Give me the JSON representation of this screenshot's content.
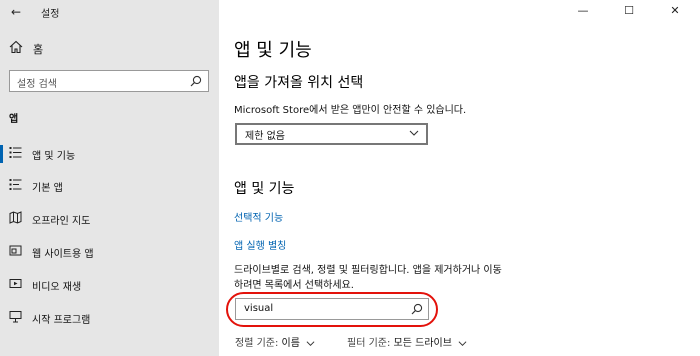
{
  "window": {
    "app_title": "설정",
    "back_glyph": "←",
    "minimize_glyph": "—",
    "maximize_glyph": "☐",
    "close_glyph": "✕"
  },
  "sidebar": {
    "home_label": "홈",
    "search_placeholder": "설정 검색",
    "section_label": "앱",
    "items": [
      {
        "label": "앱 및 기능",
        "icon": "apps-features-icon",
        "selected": true
      },
      {
        "label": "기본 앱",
        "icon": "default-apps-icon",
        "selected": false
      },
      {
        "label": "오프라인 지도",
        "icon": "offline-maps-icon",
        "selected": false
      },
      {
        "label": "웹 사이트용 앱",
        "icon": "apps-for-websites-icon",
        "selected": false
      },
      {
        "label": "비디오 재생",
        "icon": "video-playback-icon",
        "selected": false
      },
      {
        "label": "시작 프로그램",
        "icon": "startup-icon",
        "selected": false
      }
    ]
  },
  "main": {
    "page_title": "앱 및 기능",
    "install_section": {
      "heading": "앱을 가져올 위치 선택",
      "description": "Microsoft Store에서 받은 앱만이 안전할 수 있습니다.",
      "dropdown_value": "제한 없음"
    },
    "apps_section": {
      "heading": "앱 및 기능",
      "link_optional_features": "선택적 기능",
      "link_app_aliases": "앱 실행 별칭",
      "description_line1": "드라이브별로 검색, 정렬 및 필터링합니다. 앱을 제거하거나 이동",
      "description_line2": "하려면 목록에서 선택하세요.",
      "search_value": "visual",
      "sort_label": "정렬 기준:",
      "sort_value": "이름",
      "filter_label": "필터 기준:",
      "filter_value": "모든 드라이브"
    }
  },
  "colors": {
    "accent": "#0063b1",
    "sidebar_bg": "#e6e6e6",
    "highlight": "#e3120b"
  }
}
